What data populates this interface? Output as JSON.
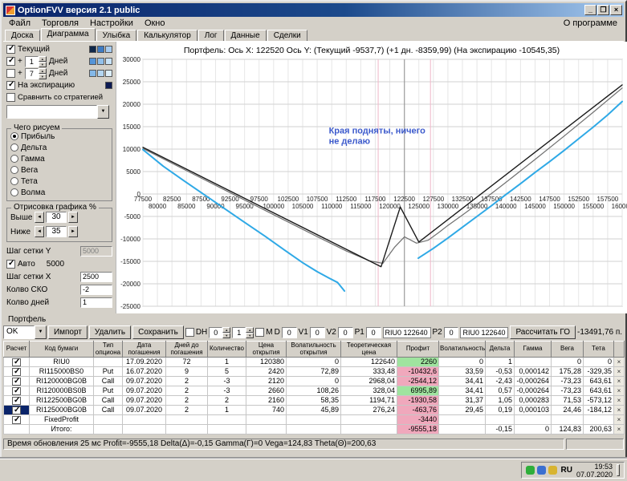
{
  "window": {
    "title": "OptionFVV версия 2.1 public"
  },
  "icons": {
    "minimize": "_",
    "maximize": "❐",
    "close": "×",
    "dropdown": "▼",
    "up": "▲",
    "down": "▼",
    "left": "◄",
    "right": "►"
  },
  "menu": {
    "items": [
      "Файл",
      "Торговля",
      "Настройки",
      "Окно"
    ],
    "right": "О программе"
  },
  "tabs": {
    "items": [
      "Доска",
      "Диаграмма",
      "Улыбка",
      "Калькулятор",
      "Лог",
      "Данные",
      "Сделки"
    ],
    "active": "Диаграмма"
  },
  "left_panel": {
    "current": {
      "label": "Текущий",
      "checked": true,
      "swatches": [
        "#10284a",
        "#3f7cc4",
        "#a8ccf0"
      ]
    },
    "plus1": {
      "plus": "+",
      "value": "1",
      "label": "Дней",
      "checked": true,
      "swatches": [
        "#5494d8",
        "#92c0ea",
        "#c8e2f6"
      ]
    },
    "plus7": {
      "plus": "+",
      "value": "7",
      "label": "Дней",
      "checked": false,
      "swatches": [
        "#84b8e8",
        "#b4d6f2",
        "#dceefa"
      ]
    },
    "expiration": {
      "label": "На экспирацию",
      "checked": true,
      "swatches": [
        "#0c1a52"
      ]
    },
    "compare": {
      "label": "Сравнить со стратегией",
      "checked": false
    },
    "strategy_value": "",
    "draw_group": {
      "title": "Чего рисуем",
      "options": [
        "Прибыль",
        "Дельта",
        "Гамма",
        "Вега",
        "Тета",
        "Волма"
      ],
      "selected": "Прибыль"
    },
    "render_group": {
      "title": "Отрисовка графика %",
      "above_label": "Выше",
      "above_value": "30",
      "below_label": "Ниже",
      "below_value": "35"
    },
    "grid_y": {
      "label": "Шаг сетки Y",
      "value": "5000"
    },
    "auto": {
      "label": "Авто",
      "checked": true,
      "value": "5000"
    },
    "grid_x": {
      "label": "Шаг сетки X",
      "value": "2500"
    },
    "sko": {
      "label": "Колво СКО",
      "value": "-2"
    },
    "days": {
      "label": "Колво дней",
      "value": "1"
    }
  },
  "chart": {
    "header": "Портфель:  Ось X: 122520 Ось Y:   (Текущий  -9537,7)   (+1 дн.  -8359,99)   (На экспирацию  -10545,35)"
  },
  "chart_data": {
    "type": "line",
    "x_range": [
      77500,
      160000
    ],
    "y_range": [
      -25000,
      30000
    ],
    "x_step": 2500,
    "y_step": 5000,
    "price_line": 122520,
    "sigma_lines": [
      118000,
      127000
    ],
    "annotation": {
      "x": 109500,
      "y": 13500,
      "lines": [
        "Края подняты, ничего",
        "не делаю"
      ],
      "color": "#3c5acc"
    },
    "series": [
      {
        "name": "Текущий",
        "color": "#707070",
        "width": 1.2,
        "segments": [
          [
            [
              77500,
              10150
            ],
            [
              85000,
              5200
            ],
            [
              92500,
              300
            ],
            [
              100000,
              -4600
            ],
            [
              107500,
              -9500
            ],
            [
              112500,
              -12700
            ],
            [
              116500,
              -14900
            ],
            [
              118800,
              -15450
            ],
            [
              120800,
              -11900
            ],
            [
              122520,
              -9537
            ],
            [
              124600,
              -10950
            ],
            [
              126600,
              -10300
            ],
            [
              128500,
              -8500
            ],
            [
              130000,
              -7000
            ],
            [
              132500,
              -4700
            ],
            [
              135000,
              -2300
            ],
            [
              137500,
              100
            ],
            [
              140000,
              2600
            ],
            [
              145000,
              7700
            ],
            [
              150000,
              12900
            ],
            [
              155000,
              18200
            ],
            [
              160000,
              23600
            ]
          ]
        ]
      },
      {
        "name": "На экспирацию",
        "color": "#1a1a1a",
        "width": 1.4,
        "segments": [
          [
            [
              77500,
              10400
            ],
            [
              118500,
              -16200
            ],
            [
              121800,
              -2900
            ],
            [
              125000,
              -10700
            ],
            [
              160000,
              24300
            ]
          ]
        ]
      },
      {
        "name": "+1 дн.",
        "color": "#2fa9e6",
        "width": 2,
        "segments": [
          [
            [
              77500,
              9900
            ],
            [
              81000,
              6200
            ],
            [
              84500,
              3000
            ],
            [
              88000,
              -100
            ],
            [
              91500,
              -3200
            ],
            [
              95000,
              -6300
            ],
            [
              98500,
              -9400
            ],
            [
              102000,
              -12600
            ],
            [
              105000,
              -15300
            ],
            [
              107500,
              -17300
            ],
            [
              109500,
              -18700
            ],
            [
              111000,
              -19700
            ],
            [
              112200,
              -21600
            ]
          ],
          [
            [
              124900,
              -14300
            ],
            [
              127500,
              -12100
            ],
            [
              130000,
              -9800
            ],
            [
              132500,
              -7400
            ],
            [
              135000,
              -5000
            ],
            [
              137500,
              -2600
            ],
            [
              140000,
              -100
            ],
            [
              142500,
              2300
            ],
            [
              145000,
              4800
            ],
            [
              147500,
              7200
            ],
            [
              150000,
              9700
            ],
            [
              152500,
              12300
            ],
            [
              155000,
              14900
            ],
            [
              157500,
              17600
            ],
            [
              160000,
              20600
            ]
          ]
        ]
      }
    ]
  },
  "portfolio": {
    "title": "Портфель",
    "controls": {
      "preset": "OK",
      "import_btn": "Импорт",
      "delete_btn": "Удалить",
      "save_btn": "Сохранить",
      "dh_label": "DH",
      "dh_checked": false,
      "dh1": "0",
      "dh2": "1",
      "m_label": "М",
      "m_checked": false,
      "d_label": "D",
      "d_value": "0",
      "v1_label": "V1",
      "v1_value": "0",
      "v2_label": "V2",
      "v2_value": "0",
      "p1_label": "P1",
      "p1_value": "0",
      "fut1": "RIU0 122640",
      "p2_label": "P2",
      "p2_value": "0",
      "fut2": "RIU0 122640",
      "calc_btn": "Рассчитать ГО",
      "result": "-13491,76 п."
    },
    "table": {
      "columns": [
        "Расчет",
        "Код бумаги",
        "Тип опциона",
        "Дата погашения",
        "Дней до погашения",
        "Количество",
        "Цена открытия",
        "Волатильность открытия",
        "Теоретическая цена",
        "Профит",
        "Волатильность",
        "Дельта",
        "Гамма",
        "Вега",
        "Тета"
      ],
      "rows": [
        {
          "checked": true,
          "selected": false,
          "profit": "green",
          "cells": [
            "RIU0",
            "",
            "17.09.2020",
            "72",
            "1",
            "120380",
            "0",
            "122640",
            "2260",
            "0",
            "1",
            "",
            "0",
            "0"
          ]
        },
        {
          "checked": true,
          "selected": false,
          "profit": "pink",
          "cells": [
            "RI115000BS0",
            "Put",
            "16.07.2020",
            "9",
            "5",
            "2420",
            "72,89",
            "333,48",
            "-10432,6",
            "33,59",
            "-0,53",
            "0,000142",
            "175,28",
            "-329,35"
          ]
        },
        {
          "checked": true,
          "selected": false,
          "profit": "pink",
          "cells": [
            "RI120000BG0B",
            "Call",
            "09.07.2020",
            "2",
            "-3",
            "2120",
            "0",
            "2968,04",
            "-2544,12",
            "34,41",
            "-2,43",
            "-0,000264",
            "-73,23",
            "643,61"
          ]
        },
        {
          "checked": true,
          "selected": false,
          "profit": "green",
          "cells": [
            "RI120000BS0B",
            "Put",
            "09.07.2020",
            "2",
            "-3",
            "2660",
            "108,26",
            "328,04",
            "6995,89",
            "34,41",
            "0,57",
            "-0,000264",
            "-73,23",
            "643,61"
          ]
        },
        {
          "checked": true,
          "selected": false,
          "profit": "pink",
          "cells": [
            "RI122500BG0B",
            "Call",
            "09.07.2020",
            "2",
            "2",
            "2160",
            "58,35",
            "1194,71",
            "-1930,58",
            "31,37",
            "1,05",
            "0,000283",
            "71,53",
            "-573,12"
          ]
        },
        {
          "checked": true,
          "selected": true,
          "profit": "pink",
          "cells": [
            "RI125000BG0B",
            "Call",
            "09.07.2020",
            "2",
            "1",
            "740",
            "45,89",
            "276,24",
            "-463,76",
            "29,45",
            "0,19",
            "0,000103",
            "24,46",
            "-184,12"
          ]
        },
        {
          "checked": true,
          "selected": false,
          "profit": "pink",
          "cells": [
            "FixedProfit",
            "",
            "",
            "",
            "",
            "",
            "",
            "",
            "-3440",
            "",
            "",
            "",
            "",
            ""
          ]
        },
        {
          "checked": null,
          "selected": false,
          "profit": "pink",
          "cells": [
            "Итого:",
            "",
            "",
            "",
            "",
            "",
            "",
            "",
            "-9555,18",
            "",
            "-0,15",
            "0",
            "124,83",
            "200,63"
          ]
        }
      ]
    }
  },
  "status_bar": "Время обновления 25 мс  Profit=-9555,18 Delta(Δ)=-0,15 Gamma(Γ)=0 Vega=124,83 Theta(Θ)=200,63",
  "taskbar": {
    "lang": "RU",
    "time": "19:53",
    "date": "07.07.2020",
    "tray_icons": [
      {
        "name": "tray-icon-green",
        "color": "#2fae3a"
      },
      {
        "name": "tray-icon-blue",
        "color": "#3b6fd0"
      },
      {
        "name": "tray-icon-yellow",
        "color": "#d8b431"
      }
    ]
  }
}
